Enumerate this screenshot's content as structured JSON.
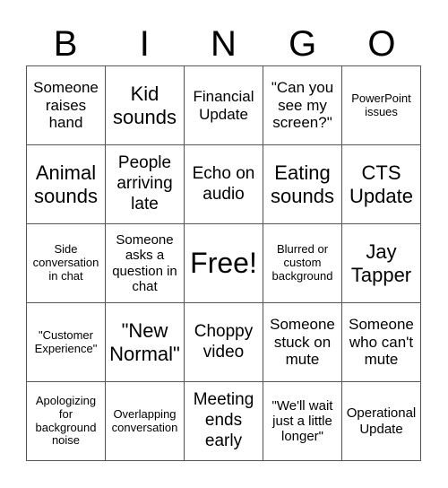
{
  "header": {
    "letters": [
      "B",
      "I",
      "N",
      "G",
      "O"
    ]
  },
  "cells": [
    "Someone raises hand",
    "Kid sounds",
    "Financial Update",
    "\"Can you see my screen?\"",
    "PowerPoint issues",
    "Animal sounds",
    "People arriving late",
    "Echo on audio",
    "Eating sounds",
    "CTS Update",
    "Side conversation in chat",
    "Someone asks a question in chat",
    "Free!",
    "Blurred or custom background",
    "Jay Tapper",
    "\"Customer Experience\"",
    "\"New Normal\"",
    "Choppy video",
    "Someone stuck on mute",
    "Someone who can't mute",
    "Apologizing for background noise",
    "Overlapping conversation",
    "Meeting ends early",
    "\"We'll wait just a little longer\"",
    "Operational Update"
  ]
}
